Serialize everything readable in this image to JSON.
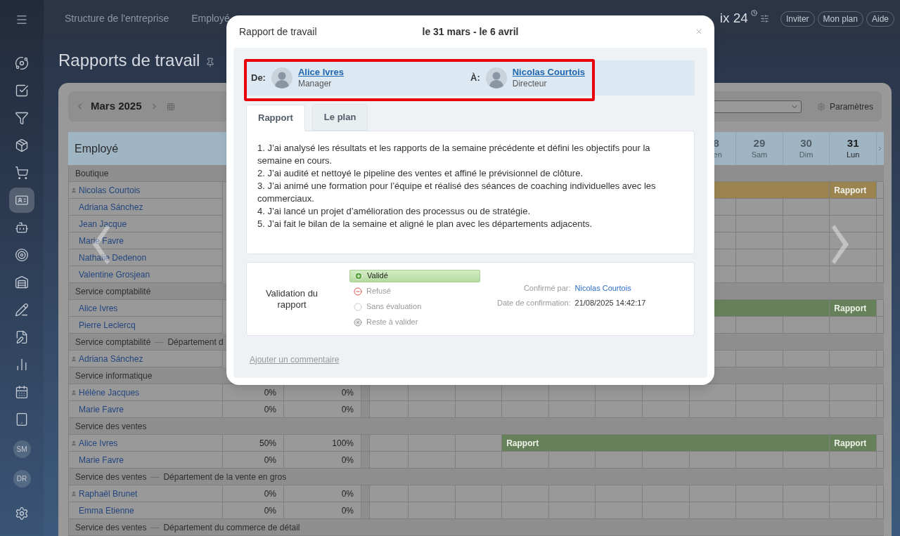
{
  "sidebar": {
    "items": [
      {
        "selected": false
      },
      {
        "selected": false
      },
      {
        "selected": false
      },
      {
        "selected": false
      },
      {
        "selected": false
      },
      {
        "selected": true
      },
      {
        "selected": false
      },
      {
        "selected": false
      },
      {
        "selected": false
      },
      {
        "selected": false
      },
      {
        "selected": false
      },
      {
        "selected": false
      },
      {
        "selected": false
      },
      {
        "selected": false
      }
    ],
    "avatars": [
      "SM",
      "DR"
    ]
  },
  "top_bar": {
    "tabs": [
      "Structure de l'entreprise",
      "Employé"
    ],
    "logo": "ix 24",
    "buttons": [
      "Inviter",
      "Mon plan",
      "Aide"
    ]
  },
  "page": {
    "title": "Rapports de travail"
  },
  "toolbar": {
    "month": "Mars 2025",
    "settings": "Paramètres"
  },
  "table": {
    "header": "Employé",
    "days": [
      {
        "number": "8",
        "weekday": "en",
        "today": false
      },
      {
        "number": "29",
        "weekday": "Sam",
        "today": false
      },
      {
        "number": "30",
        "weekday": "Dim",
        "today": false
      },
      {
        "number": "31",
        "weekday": "Lun",
        "today": true
      }
    ],
    "rows": [
      {
        "kind": "group",
        "name": "Boutique"
      },
      {
        "kind": "employee",
        "name": "Nicolas Courtois",
        "head": true,
        "weeks": [
          {
            "report": true,
            "color": "#9b8450"
          },
          {
            "report": true,
            "color": "#9b8450",
            "label": "Rapport"
          }
        ]
      },
      {
        "kind": "employee",
        "name": "Adriana Sánchez",
        "head": false
      },
      {
        "kind": "employee",
        "name": "Jean Jacque",
        "head": false
      },
      {
        "kind": "employee",
        "name": "Marie Favre",
        "head": false
      },
      {
        "kind": "employee",
        "name": "Nathalie Dedenon",
        "head": false
      },
      {
        "kind": "employee",
        "name": "Valentine Grosjean",
        "head": false
      },
      {
        "kind": "group",
        "name": "Service comptabilité"
      },
      {
        "kind": "employee",
        "name": "Alice Ivres",
        "head": false,
        "weeks": [
          {
            "report": true,
            "color": "#66805a"
          },
          {
            "report": true,
            "color": "#66805a",
            "label": "Rapport"
          }
        ]
      },
      {
        "kind": "employee",
        "name": "Pierre Leclercq",
        "head": false
      },
      {
        "kind": "group",
        "name": "Service comptabilité",
        "separator": "—",
        "sub": "Département d"
      },
      {
        "kind": "employee",
        "name": "Adriana Sánchez",
        "head": true
      },
      {
        "kind": "group",
        "name": "Service informatique"
      },
      {
        "kind": "employee",
        "name": "Hélène Jacques",
        "head": true,
        "col_2": "0%",
        "col_3": "0%"
      },
      {
        "kind": "employee",
        "name": "Marie Favre",
        "head": false,
        "col_2": "0%",
        "col_3": "0%"
      },
      {
        "kind": "group",
        "name": "Service des ventes"
      },
      {
        "kind": "employee",
        "name": "Alice Ivres",
        "head": true,
        "col_2": "50%",
        "col_3": "100%",
        "weeks": [
          {
            "report": true,
            "color": "#66805a",
            "label": "Rapport"
          },
          {
            "report": true,
            "color": "#66805a",
            "label": "Rapport"
          }
        ]
      },
      {
        "kind": "employee",
        "name": "Marie Favre",
        "head": false,
        "col_2": "0%",
        "col_3": "0%"
      },
      {
        "kind": "group",
        "name": "Service des ventes",
        "separator": "—",
        "sub": "Département de la vente en gros"
      },
      {
        "kind": "employee",
        "name": "Raphaël Brunet",
        "head": true,
        "col_2": "0%",
        "col_3": "0%"
      },
      {
        "kind": "employee",
        "name": "Emma Etienne",
        "head": false,
        "col_2": "0%",
        "col_3": "0%"
      },
      {
        "kind": "group",
        "name": "Service des ventes",
        "separator": "—",
        "sub": "Département du commerce de détail"
      }
    ]
  },
  "dialog": {
    "title": "Rapport de travail",
    "period": "le 31 mars - le 6 avril",
    "participants": {
      "highlighted": true,
      "from": {
        "label": "De:",
        "name": "Alice Ivres",
        "role": "Manager"
      },
      "to": {
        "label": "À:",
        "name": "Nicolas Courtois",
        "role": "Directeur"
      }
    },
    "tabs": [
      {
        "label": "Rapport",
        "selected": true
      },
      {
        "label": "Le plan",
        "selected": false
      }
    ],
    "report_lines": [
      "1. J’ai analysé les résultats et les rapports de la semaine précédente et défini les objectifs pour la semaine en cours.",
      "2. J’ai audité et nettoyé le pipeline des ventes et affiné le prévisionnel de clôture.",
      "3. J’ai animé une formation pour l’équipe et réalisé des séances de coaching individuelles avec les commerciaux.",
      "4. J’ai lancé un projet d’amélioration des processus ou de stratégie.",
      "5. J’ai fait le bilan de la semaine et aligné le plan avec les départements adjacents."
    ],
    "validation": {
      "label": "Validation du rapport",
      "options": [
        {
          "kind": "approve",
          "label": "Validé",
          "selected": true
        },
        {
          "kind": "reject",
          "label": "Refusé",
          "selected": false
        },
        {
          "kind": "none",
          "label": "Sans évaluation",
          "selected": false
        },
        {
          "kind": "pending",
          "label": "Reste à valider",
          "selected": false
        }
      ],
      "confirmed_by_label": "Confirmé par:",
      "confirmed_by": "Nicolas Courtois",
      "date_label": "Date de confirmation:",
      "date": "21/08/2025 14:42:17"
    },
    "comment_link": "Ajouter un commentaire"
  }
}
